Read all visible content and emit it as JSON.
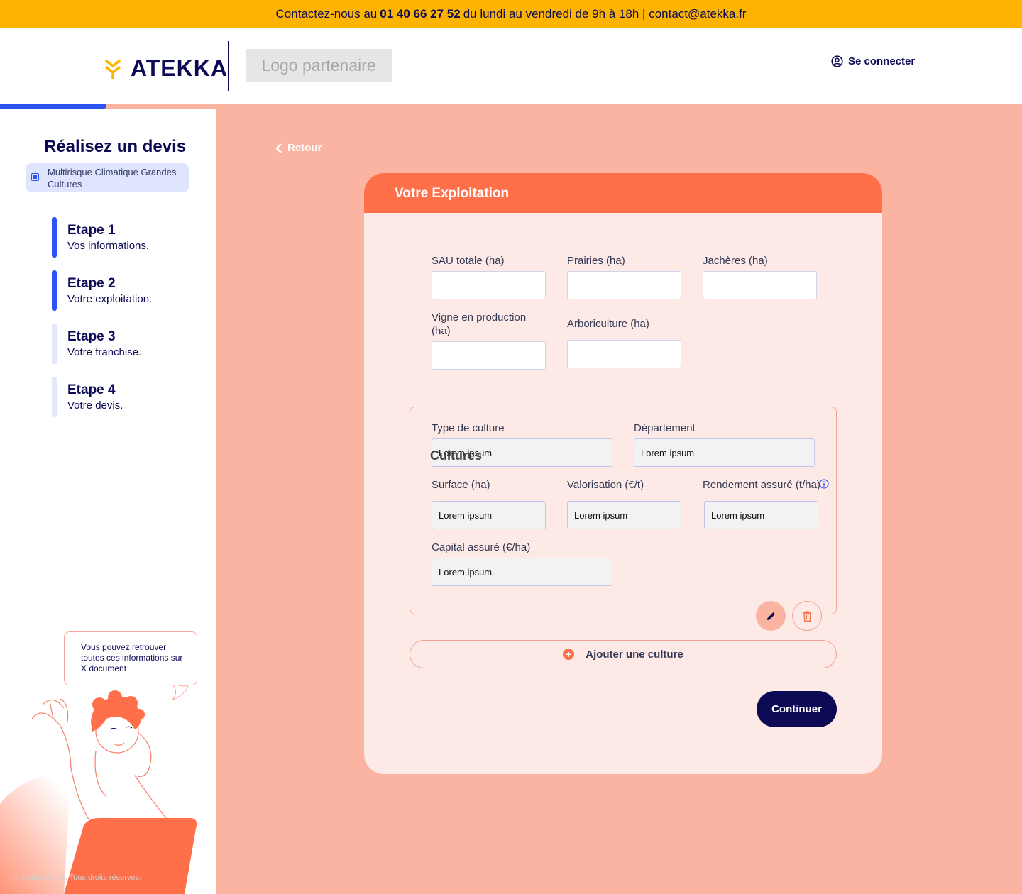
{
  "topbar": {
    "prefix": "Contactez-nous au",
    "phone": "01 40 66 27 52",
    "suffix": "du lundi au vendredi de 9h à 18h | contact@atekka.fr"
  },
  "header": {
    "logo_text": "ATEKKA",
    "partner_logo": "Logo partenaire",
    "login_label": "Se connecter"
  },
  "sidebar": {
    "title": "Réalisez un devis",
    "product": "Multirisque Climatique Grandes Cultures",
    "steps": [
      {
        "title": "Etape 1",
        "subtitle": "Vos informations.",
        "active": true
      },
      {
        "title": "Etape 2",
        "subtitle": "Votre exploitation.",
        "active": true
      },
      {
        "title": "Etape 3",
        "subtitle": "Votre franchise.",
        "active": false
      },
      {
        "title": "Etape 4",
        "subtitle": "Votre devis.",
        "active": false
      }
    ],
    "help_text": "Vous pouvez retrouver toutes ces informations sur X document",
    "footer": "© Atekka 2023. Tous droits réservés."
  },
  "main": {
    "back_label": "Retour",
    "card_title": "Votre Exploitation",
    "fields": {
      "sau_label": "SAU totale (ha)",
      "prairies_label": "Prairies (ha)",
      "jacheres_label": "Jachères (ha)",
      "vigne_label": "Vigne en production (ha)",
      "arbo_label": "Arboriculture (ha)"
    },
    "cultures": {
      "legend": "Cultures",
      "type_label": "Type de culture",
      "type_value": "Lorem ipsum",
      "dept_label": "Département",
      "dept_value": "Lorem ipsum",
      "surface_label": "Surface (ha)",
      "surface_value": "Lorem ipsum",
      "valo_label": "Valorisation (€/t)",
      "valo_value": "Lorem ipsum",
      "rendement_label": "Rendement assuré (t/ha)",
      "rendement_value": "Lorem ipsum",
      "capital_label": "Capital assuré (€/ha)",
      "capital_value": "Lorem ipsum"
    },
    "add_label": "Ajouter une culture",
    "continue_label": "Continuer"
  },
  "icons": {
    "login": "user-circle-icon",
    "back": "chevron-left-icon",
    "edit": "pencil-icon",
    "delete": "trash-icon",
    "add": "plus-circle-icon",
    "info": "info-icon"
  },
  "colors": {
    "topbar": "#fcb400",
    "navy": "#0d0a55",
    "accent_blue": "#2d52f5",
    "orange": "#ff6f4a",
    "salmon": "#fbb4a1",
    "card_bg": "#fde9e6"
  }
}
